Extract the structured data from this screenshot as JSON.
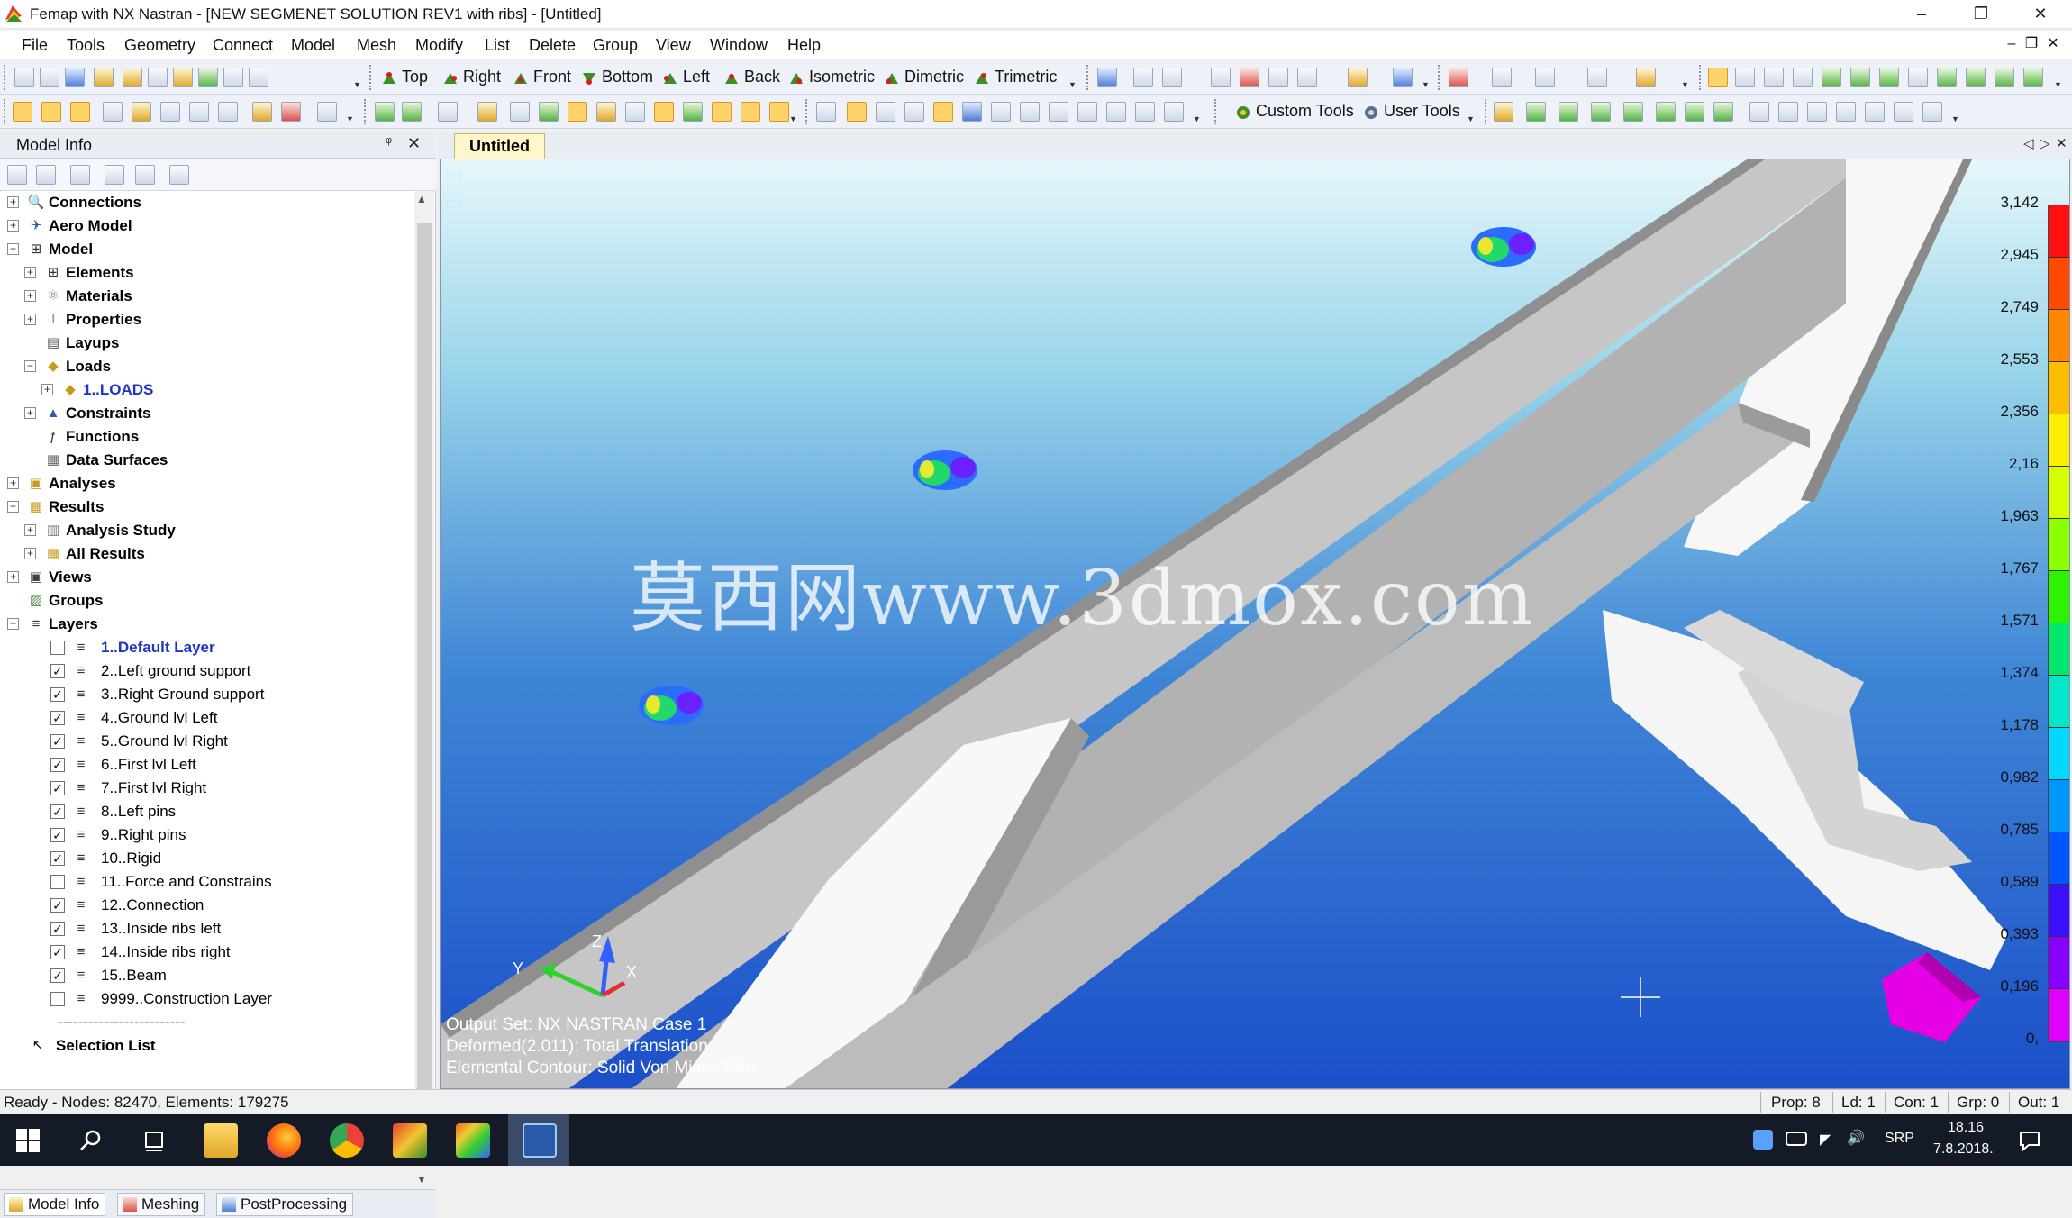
{
  "window": {
    "title": "Femap with NX Nastran - [NEW SEGMENET SOLUTION REV1 with ribs] - [Untitled]",
    "minimize_icon": "minimize-icon",
    "maximize_icon": "restore-icon",
    "close_icon": "close-icon"
  },
  "menu": {
    "items": [
      "File",
      "Tools",
      "Geometry",
      "Connect",
      "Model",
      "Mesh",
      "Modify",
      "List",
      "Delete",
      "Group",
      "View",
      "Window",
      "Help"
    ],
    "right_controls": [
      "–",
      "❐",
      "✕"
    ]
  },
  "toolbar1": {
    "views": [
      "Top",
      "Right",
      "Front",
      "Bottom",
      "Left",
      "Back",
      "Isometric",
      "Dimetric",
      "Trimetric"
    ]
  },
  "toolbar2": {
    "custom_tools": "Custom Tools",
    "user_tools": "User Tools"
  },
  "model_info": {
    "title": "Model Info",
    "pin": "ᵠ",
    "close": "✕",
    "tree": [
      {
        "label": "Connections",
        "level": 0,
        "exp": "+",
        "icon": "magnifier-icon",
        "style": "bold"
      },
      {
        "label": "Aero Model",
        "level": 0,
        "exp": "+",
        "icon": "aero-icon",
        "style": "bold"
      },
      {
        "label": "Model",
        "level": 0,
        "exp": "−",
        "icon": "grid-icon",
        "style": "bold"
      },
      {
        "label": "Elements",
        "level": 1,
        "exp": "+",
        "icon": "grid-icon",
        "style": "bold"
      },
      {
        "label": "Materials",
        "level": 1,
        "exp": "+",
        "icon": "materials-icon",
        "style": "bold"
      },
      {
        "label": "Properties",
        "level": 1,
        "exp": "+",
        "icon": "properties-icon",
        "style": "bold"
      },
      {
        "label": "Layups",
        "level": 1,
        "exp": "",
        "icon": "layups-icon",
        "style": "bold"
      },
      {
        "label": "Loads",
        "level": 1,
        "exp": "−",
        "icon": "loads-icon",
        "style": "bold"
      },
      {
        "label": "1..LOADS",
        "level": 2,
        "exp": "+",
        "icon": "load-set-icon",
        "style": "blue"
      },
      {
        "label": "Constraints",
        "level": 1,
        "exp": "+",
        "icon": "constraints-icon",
        "style": "bold"
      },
      {
        "label": "Functions",
        "level": 1,
        "exp": "",
        "icon": "function-icon",
        "style": "bold"
      },
      {
        "label": "Data Surfaces",
        "level": 1,
        "exp": "",
        "icon": "data-surface-icon",
        "style": "bold"
      },
      {
        "label": "Analyses",
        "level": 0,
        "exp": "+",
        "icon": "analysis-icon",
        "style": "bold"
      },
      {
        "label": "Results",
        "level": 0,
        "exp": "−",
        "icon": "results-icon",
        "style": "bold"
      },
      {
        "label": "Analysis Study",
        "level": 1,
        "exp": "+",
        "icon": "book-icon",
        "style": "bold"
      },
      {
        "label": "All Results",
        "level": 1,
        "exp": "+",
        "icon": "results-icon",
        "style": "bold"
      },
      {
        "label": "Views",
        "level": 0,
        "exp": "+",
        "icon": "views-icon",
        "style": "bold"
      },
      {
        "label": "Groups",
        "level": 0,
        "exp": "",
        "icon": "groups-icon",
        "style": "bold"
      },
      {
        "label": "Layers",
        "level": 0,
        "exp": "−",
        "icon": "layers-icon",
        "style": "bold"
      }
    ],
    "layers": [
      {
        "label": "1..Default Layer",
        "checked": false,
        "style": "blue"
      },
      {
        "label": "2..Left ground support",
        "checked": true
      },
      {
        "label": "3..Right Ground support",
        "checked": true
      },
      {
        "label": "4..Ground lvl Left",
        "checked": true
      },
      {
        "label": "5..Ground lvl Right",
        "checked": true
      },
      {
        "label": "6..First lvl Left",
        "checked": true
      },
      {
        "label": "7..First lvl Right",
        "checked": true
      },
      {
        "label": "8..Left pins",
        "checked": true
      },
      {
        "label": "9..Right pins",
        "checked": true
      },
      {
        "label": "10..Rigid",
        "checked": true
      },
      {
        "label": "11..Force and Constrains",
        "checked": false
      },
      {
        "label": "12..Connection",
        "checked": true
      },
      {
        "label": "13..Inside ribs left",
        "checked": true
      },
      {
        "label": "14..Inside ribs right",
        "checked": true
      },
      {
        "label": "15..Beam",
        "checked": true
      },
      {
        "label": "9999..Construction Layer",
        "checked": false
      }
    ],
    "separator": "-------------------------",
    "selection_list": "Selection List"
  },
  "bottom_tabs": [
    "Model Info",
    "Meshing",
    "PostProcessing"
  ],
  "viewport": {
    "tab": "Untitled",
    "tab_controls": [
      "◁",
      "▷",
      "✕"
    ],
    "corner": [
      "V:1",
      "L:1",
      "C:1"
    ],
    "output_set": "Output Set: NX NASTRAN Case 1",
    "deformed": "Deformed(2.011): Total Translation",
    "contour": "Elemental Contour: Solid Von Mises Stre",
    "watermark": "莫西网www.3dmox.com",
    "axes": {
      "x": "X",
      "y": "Y",
      "z": "Z"
    },
    "legend": {
      "values": [
        "3,142",
        "2,945",
        "2,749",
        "2,553",
        "2,356",
        "2,16",
        "1,963",
        "1,767",
        "1,571",
        "1,374",
        "1,178",
        "0,982",
        "0,785",
        "0,589",
        "0,393",
        "0,196",
        "0,"
      ],
      "colors": [
        "#ff1010",
        "#ff4a00",
        "#ff8800",
        "#ffbd00",
        "#ffee00",
        "#d6ff00",
        "#8cff00",
        "#2ef200",
        "#00e86e",
        "#00e8c8",
        "#00d8ff",
        "#0096ff",
        "#0055ff",
        "#3a10ff",
        "#8800ff",
        "#e000ff"
      ]
    }
  },
  "status": {
    "left": "Ready - Nodes: 82470,  Elements: 179275",
    "prop": "Prop: 8",
    "ld": "Ld: 1",
    "con": "Con: 1",
    "grp": "Grp: 0",
    "out": "Out: 1"
  },
  "taskbar": {
    "time": "18.16",
    "date": "7.8.2018.",
    "lang": "SRP"
  }
}
